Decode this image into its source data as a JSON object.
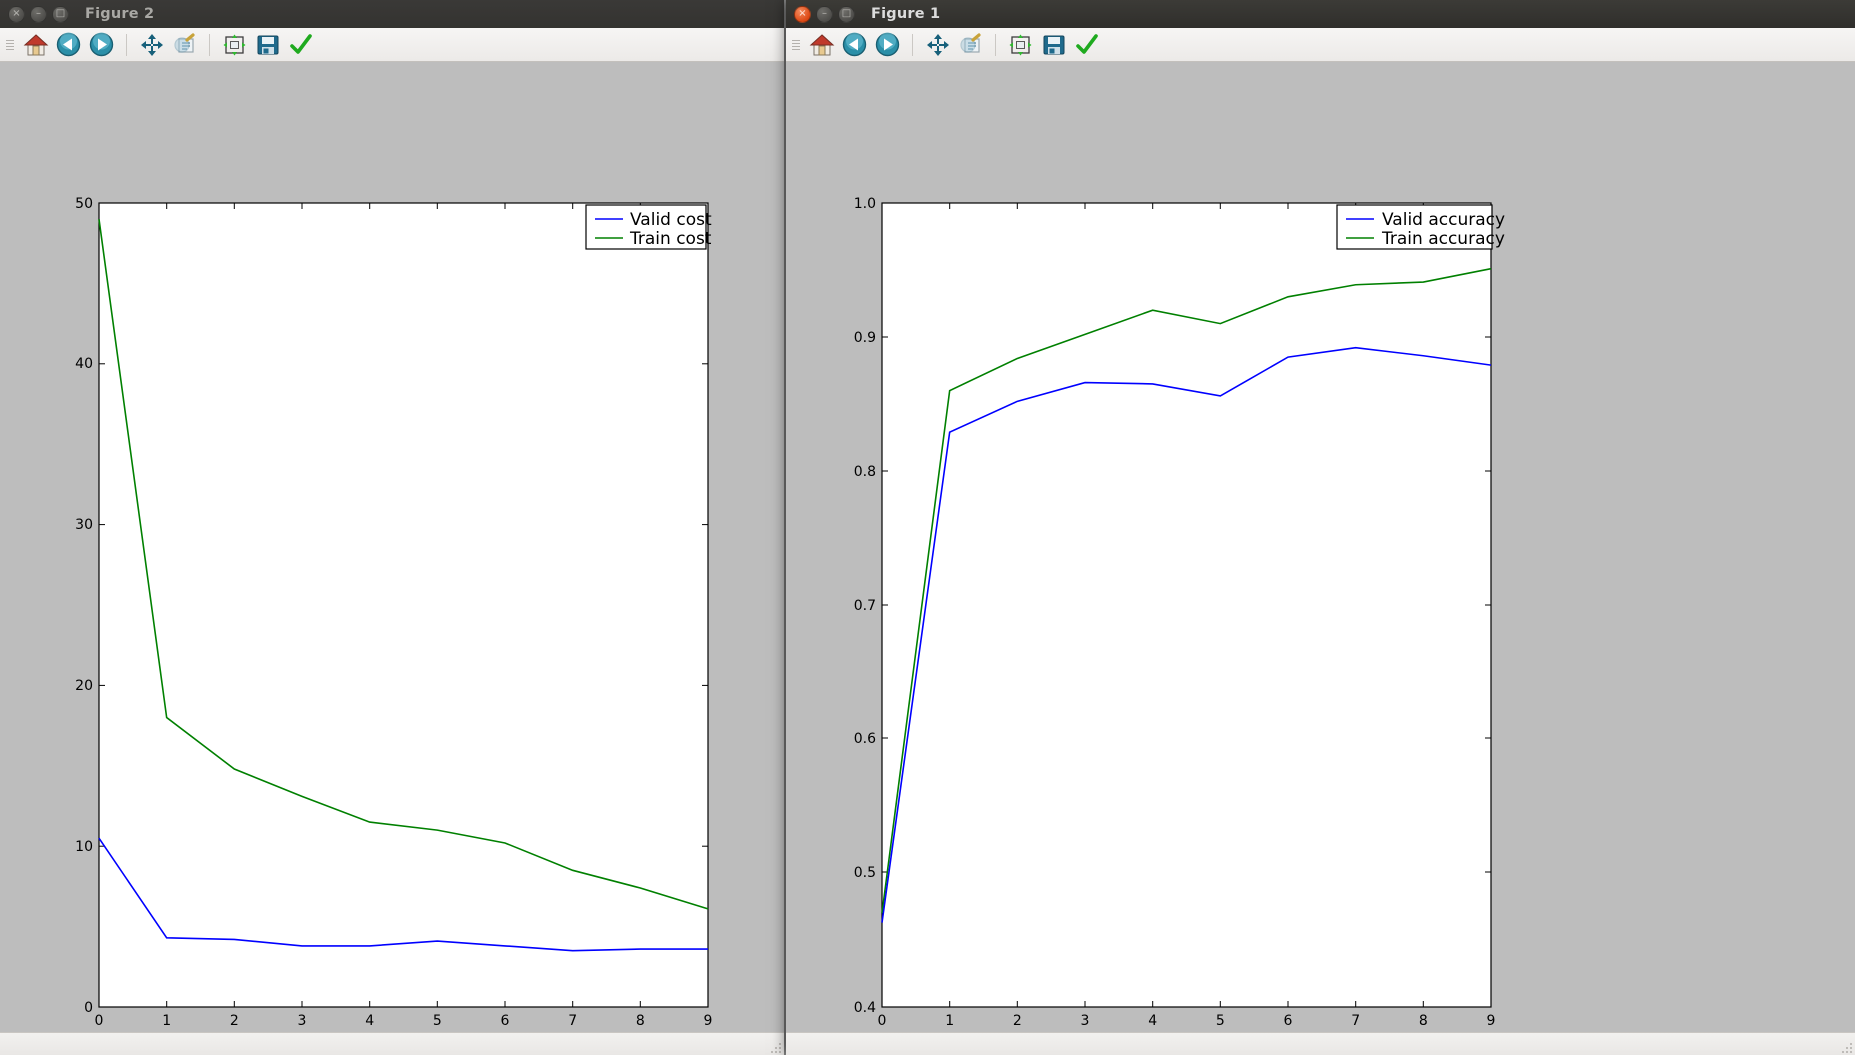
{
  "desktop": {
    "background_color": "#9c9c9c"
  },
  "windows": [
    {
      "id": "figure2",
      "title": "Figure 2",
      "focused": false,
      "controls": {
        "close": "×",
        "minimize": "–",
        "maximize": "□"
      },
      "toolbar": {
        "buttons": [
          {
            "name": "home-icon",
            "label": "Home"
          },
          {
            "name": "back-arrow-icon",
            "label": "Back"
          },
          {
            "name": "forward-arrow-icon",
            "label": "Forward"
          },
          {
            "name": "pan-move-icon",
            "label": "Pan"
          },
          {
            "name": "zoom-rect-icon",
            "label": "Zoom to rectangle"
          },
          {
            "name": "configure-subplots-icon",
            "label": "Configure subplots"
          },
          {
            "name": "save-floppy-icon",
            "label": "Save"
          },
          {
            "name": "green-check-icon",
            "label": "Apply"
          }
        ]
      }
    },
    {
      "id": "figure1",
      "title": "Figure 1",
      "focused": true,
      "controls": {
        "close": "×",
        "minimize": "–",
        "maximize": "□"
      },
      "toolbar": {
        "buttons": [
          {
            "name": "home-icon",
            "label": "Home"
          },
          {
            "name": "back-arrow-icon",
            "label": "Back"
          },
          {
            "name": "forward-arrow-icon",
            "label": "Forward"
          },
          {
            "name": "pan-move-icon",
            "label": "Pan"
          },
          {
            "name": "zoom-rect-icon",
            "label": "Zoom to rectangle"
          },
          {
            "name": "configure-subplots-icon",
            "label": "Configure subplots"
          },
          {
            "name": "save-floppy-icon",
            "label": "Save"
          },
          {
            "name": "green-check-icon",
            "label": "Apply"
          }
        ]
      }
    }
  ],
  "colors": {
    "valid_series": "#0000ff",
    "train_series": "#008000",
    "figure_face": "#bdbdbd",
    "axes_face": "#ffffff",
    "axis_line": "#000000"
  },
  "chart_data": [
    {
      "id": "cost-chart",
      "window": "Figure 2",
      "type": "line",
      "title": "",
      "xlabel": "",
      "ylabel": "",
      "x": [
        0,
        1,
        2,
        3,
        4,
        5,
        6,
        7,
        8,
        9
      ],
      "xlim": [
        0,
        9
      ],
      "ylim": [
        0,
        50
      ],
      "xticks": [
        "0",
        "1",
        "2",
        "3",
        "4",
        "5",
        "6",
        "7",
        "8",
        "9"
      ],
      "yticks": [
        "0",
        "10",
        "20",
        "30",
        "40",
        "50"
      ],
      "grid": false,
      "legend_position": "upper right",
      "series": [
        {
          "name": "Valid cost",
          "color": "#0000ff",
          "values": [
            10.5,
            4.3,
            4.2,
            3.8,
            3.8,
            4.1,
            3.8,
            3.5,
            3.6,
            3.6
          ]
        },
        {
          "name": "Train cost",
          "color": "#008000",
          "values": [
            49.0,
            18.0,
            14.8,
            13.1,
            11.5,
            11.0,
            10.2,
            8.5,
            7.4,
            6.1
          ]
        }
      ]
    },
    {
      "id": "accuracy-chart",
      "window": "Figure 1",
      "type": "line",
      "title": "",
      "xlabel": "",
      "ylabel": "",
      "x": [
        0,
        1,
        2,
        3,
        4,
        5,
        6,
        7,
        8,
        9
      ],
      "xlim": [
        0,
        9
      ],
      "ylim": [
        0.4,
        1.0
      ],
      "xticks": [
        "0",
        "1",
        "2",
        "3",
        "4",
        "5",
        "6",
        "7",
        "8",
        "9"
      ],
      "yticks": [
        "0.4",
        "0.5",
        "0.6",
        "0.7",
        "0.8",
        "0.9",
        "1.0"
      ],
      "grid": false,
      "legend_position": "upper right",
      "series": [
        {
          "name": "Valid accuracy",
          "color": "#0000ff",
          "values": [
            0.463,
            0.829,
            0.852,
            0.866,
            0.865,
            0.856,
            0.885,
            0.892,
            0.886,
            0.879
          ]
        },
        {
          "name": "Train accuracy",
          "color": "#008000",
          "values": [
            0.47,
            0.86,
            0.884,
            0.902,
            0.92,
            0.91,
            0.93,
            0.939,
            0.941,
            0.951
          ]
        }
      ]
    }
  ]
}
